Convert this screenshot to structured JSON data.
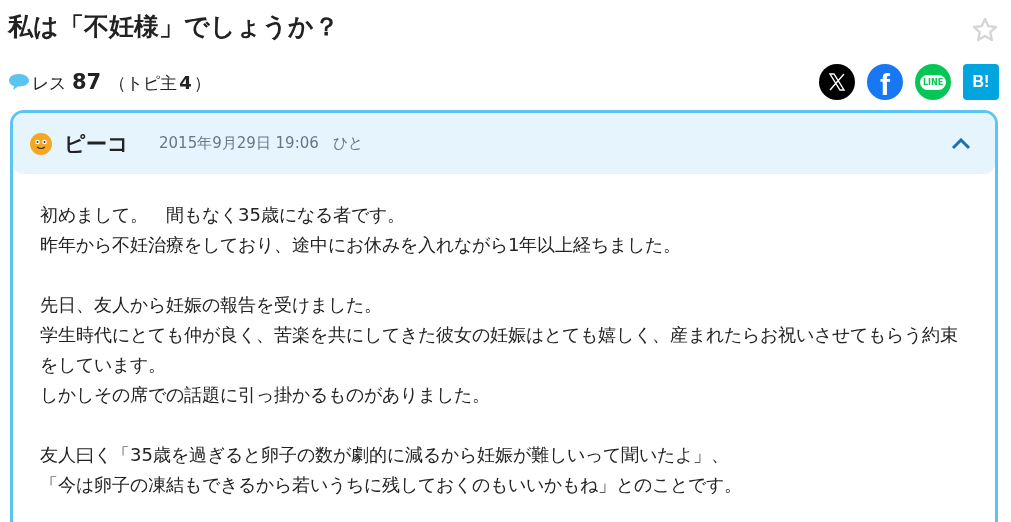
{
  "title": "私は「不妊様」でしょうか？",
  "stats": {
    "res_label": "レス",
    "res_count": "87",
    "owner_open": "（トピ主",
    "owner_count": "4",
    "owner_close": "）"
  },
  "shares": [
    {
      "kind": "x"
    },
    {
      "kind": "facebook",
      "label": "f"
    },
    {
      "kind": "line",
      "label": "LINE"
    },
    {
      "kind": "hatena",
      "label": "B!"
    }
  ],
  "post": {
    "author": "ピーコ",
    "date": "2015年9月29日 19:06",
    "tag": "ひと",
    "expanded": true,
    "paragraphs": [
      [
        "初めまして。　間もなく35歳になる者です。",
        "昨年から不妊治療をしており、途中にお休みを入れながら1年以上経ちました。"
      ],
      [
        "先日、友人から妊娠の報告を受けました。",
        "学生時代にとても仲が良く、苦楽を共にしてきた彼女の妊娠はとても嬉しく、産まれたらお祝いさせてもらう約束をしています。",
        "しかしその席での話題に引っ掛かるものがありました。"
      ],
      [
        "友人曰く「35歳を過ぎると卵子の数が劇的に減るから妊娠が難しいって聞いたよ」、",
        "「今は卵子の凍結もできるから若いうちに残しておくのもいいかもね」とのことです。"
      ]
    ]
  }
}
